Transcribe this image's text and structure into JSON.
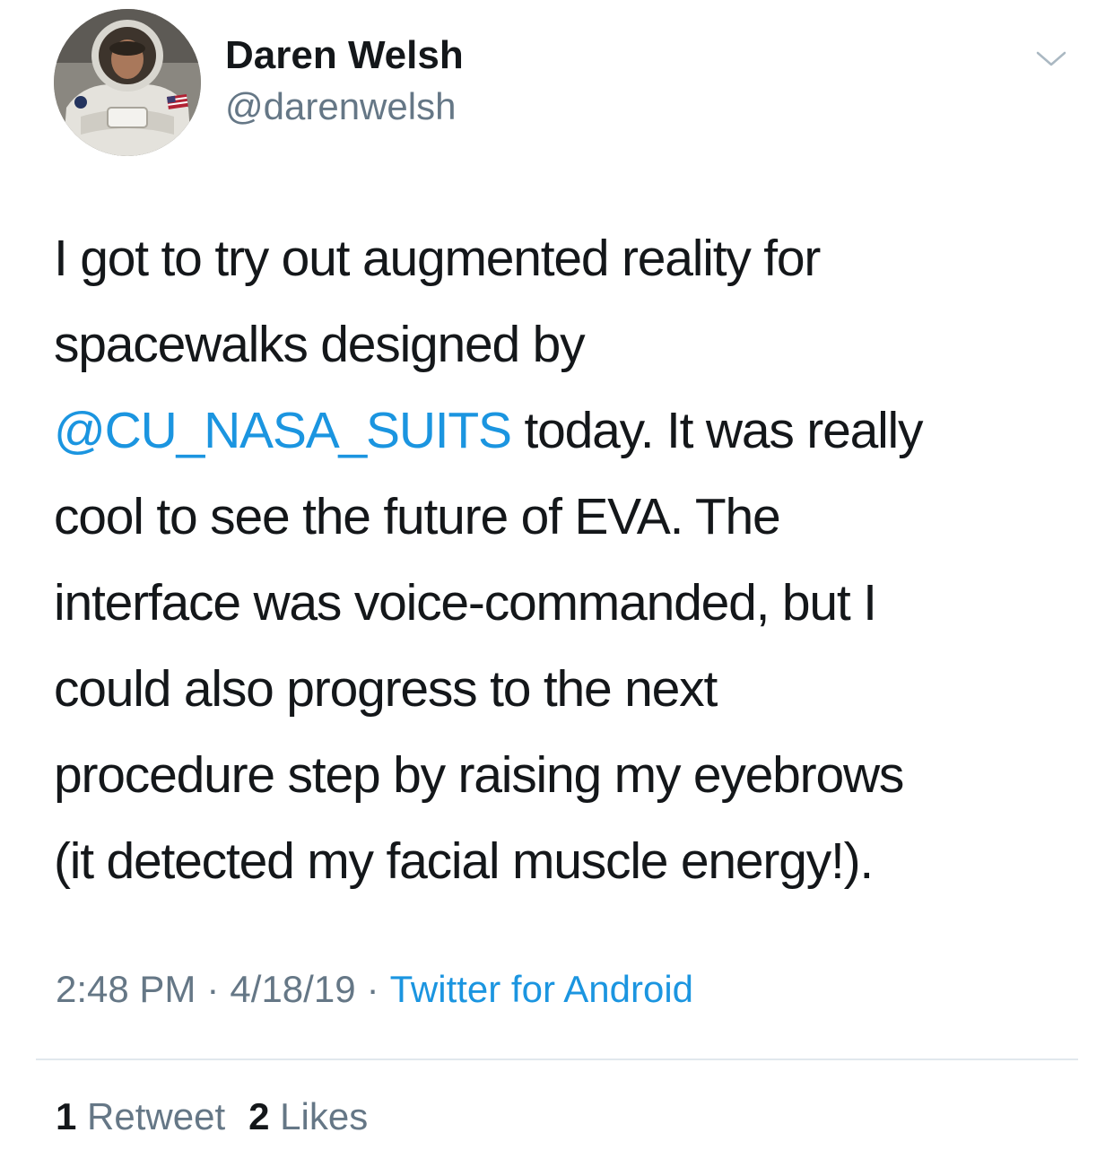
{
  "author": {
    "display_name": "Daren Welsh",
    "handle": "@darenwelsh",
    "avatar_icon": "astronaut-avatar"
  },
  "menu_icon": "chevron-down-icon",
  "tweet": {
    "lines": [
      {
        "text": "I got to try out augmented reality for"
      },
      {
        "text": "spacewalks designed by"
      },
      {
        "mention": "@CU_NASA_SUITS",
        "text": " today. It was really"
      },
      {
        "text": "cool to see the future of EVA. The"
      },
      {
        "text": "interface was voice-commanded, but I"
      },
      {
        "text": "could also progress to the next"
      },
      {
        "text": "procedure step by raising my eyebrows"
      },
      {
        "text": "(it detected my facial muscle energy!)."
      }
    ]
  },
  "meta": {
    "time": "2:48 PM",
    "date": "4/18/19",
    "separator": "·",
    "source": "Twitter for Android"
  },
  "stats": {
    "retweet_count": "1",
    "retweet_label": "Retweet",
    "like_count": "2",
    "like_label": "Likes"
  },
  "colors": {
    "link": "#1b95e0",
    "secondary_text": "#657786",
    "primary_text": "#14171a",
    "divider": "#e1e8ed"
  }
}
